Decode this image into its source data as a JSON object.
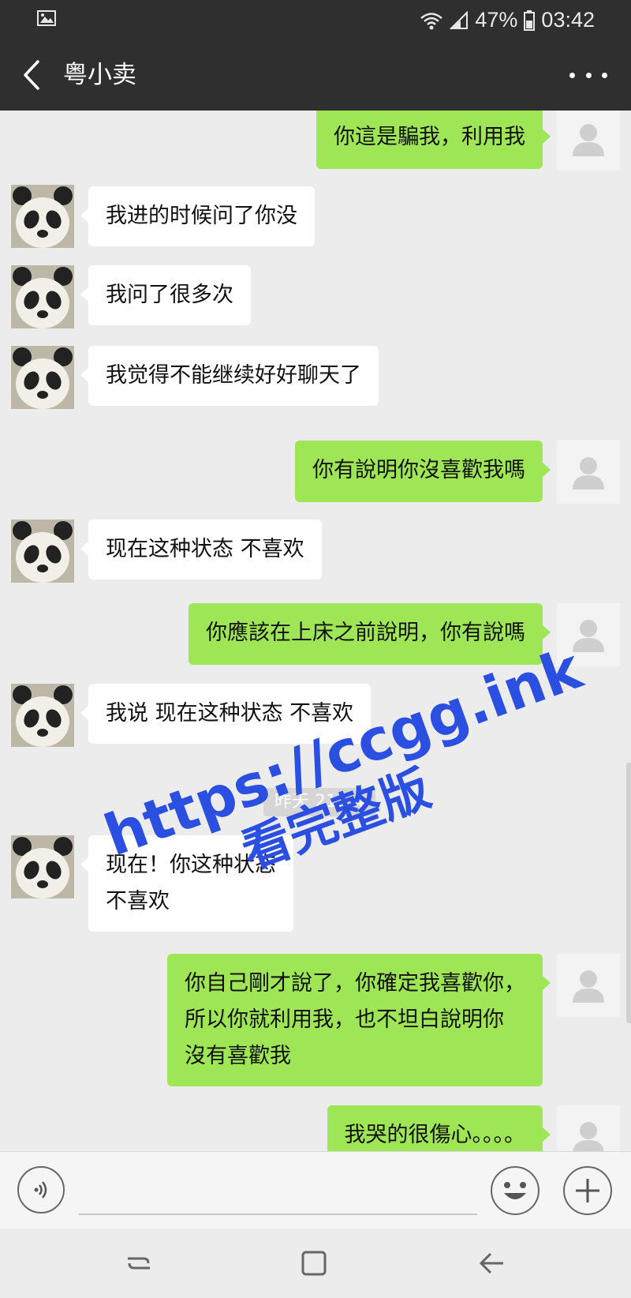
{
  "status_bar": {
    "battery": "47%",
    "time": "03:42"
  },
  "header": {
    "title": "粤小卖"
  },
  "messages": [
    {
      "side": "right",
      "text": "你這是騙我，利用我"
    },
    {
      "side": "left",
      "text": "我进的时候问了你没"
    },
    {
      "side": "left",
      "text": "我问了很多次"
    },
    {
      "side": "left",
      "text": "我觉得不能继续好好聊天了"
    },
    {
      "side": "right",
      "text": "你有說明你沒喜歡我嗎"
    },
    {
      "side": "left",
      "text": "现在这种状态 不喜欢"
    },
    {
      "side": "right",
      "text": "你應該在上床之前說明，你有說嗎"
    },
    {
      "side": "left",
      "text": "我说 现在这种状态 不喜欢"
    },
    {
      "side": "left",
      "text": "现在！你这种状态\n不喜欢"
    },
    {
      "side": "right",
      "text": "你自己剛才說了，你確定我喜歡你，\n所以你就利用我，也不坦白說明你\n沒有喜歡我"
    },
    {
      "side": "right",
      "text": "我哭的很傷心。。。。"
    }
  ],
  "timestamp": "昨天 21:04",
  "watermark": {
    "line1": "https://ccgg.ink",
    "line2": "看完整版"
  },
  "icons": {
    "back": "back-arrow-icon",
    "more": "more-dots-icon",
    "voice": "voice-icon",
    "emoji": "emoji-icon",
    "plus": "plus-icon"
  },
  "colors": {
    "sent_bubble": "#9fe657",
    "received_bubble": "#ffffff",
    "header": "#2f2f2f",
    "watermark": "#2b4fe0"
  }
}
